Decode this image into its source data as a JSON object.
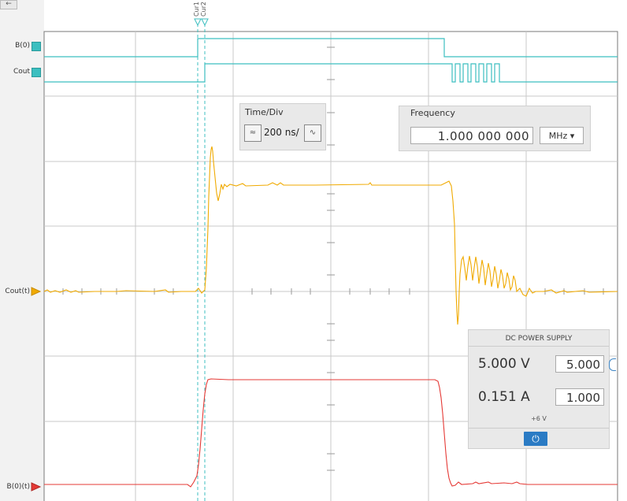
{
  "nav": {
    "back_glyph": "←"
  },
  "channels": {
    "b0": {
      "label": "B(0)",
      "color": "#3cbfc0"
    },
    "cout": {
      "label": "Cout",
      "color": "#3cbfc0"
    },
    "cout_t": {
      "label": "Cout(t)",
      "color": "#f0aa00"
    },
    "b0_t": {
      "label": "B(0)(t)",
      "color": "#e53935"
    }
  },
  "cursors": {
    "cur1": "Cur1",
    "cur2": "Cur2",
    "color": "#3cbfc0"
  },
  "time_div": {
    "title": "Time/Div",
    "value": "200 ns/",
    "dec_glyph": "≈",
    "inc_glyph": "∿"
  },
  "frequency": {
    "title": "Frequency",
    "value": "1.000 000 000",
    "unit": "MHz ▾"
  },
  "dc_supply": {
    "title": "DC POWER SUPPLY",
    "voltage_reading": "5.000 V",
    "voltage_set": "5.000",
    "current_reading": "0.151 A",
    "current_set": "1.000",
    "rail": "+6 V",
    "power_glyph": "⏻"
  }
}
